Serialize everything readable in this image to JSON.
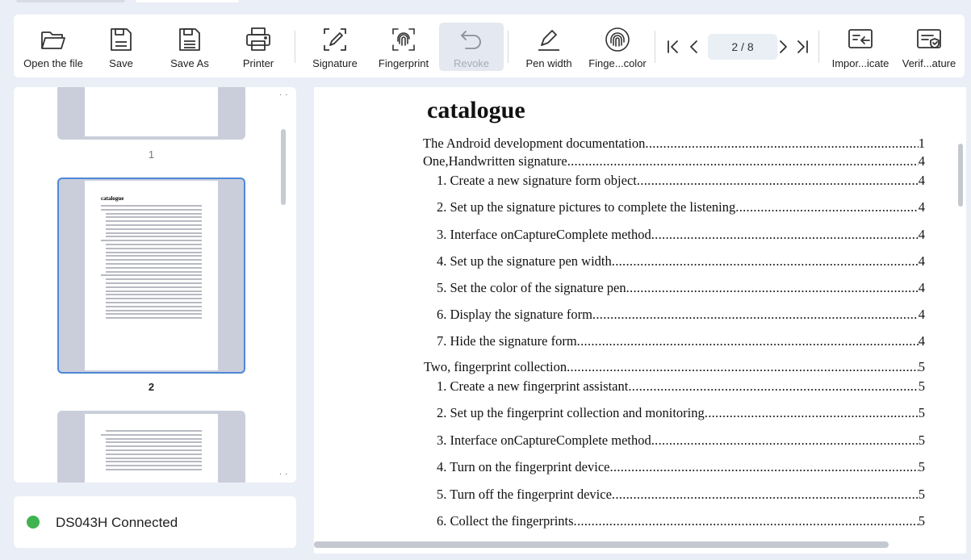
{
  "toolbar": {
    "open": "Open the file",
    "save": "Save",
    "save_as": "Save As",
    "printer": "Printer",
    "signature": "Signature",
    "fingerprint": "Fingerprint",
    "revoke": "Revoke",
    "pen_width": "Pen width",
    "fingerprint_color": "Finge...color",
    "page_indicator": "2 / 8",
    "import_certificate": "Impor...icate",
    "verify_signature": "Verif...ature"
  },
  "thumbnails": {
    "items": [
      {
        "label": "1"
      },
      {
        "label": "2"
      }
    ],
    "mini_title": "catalogue",
    "dots": ". ."
  },
  "status": {
    "text": "DS043H Connected",
    "color": "#3fb34f"
  },
  "document": {
    "title": "catalogue",
    "toc": [
      {
        "text": "The Android development documentation ",
        "page": "1"
      },
      {
        "text": "One,Handwritten signature",
        "page": "4"
      },
      {
        "text": "1. Create a new signature form object",
        "page": "4"
      },
      {
        "text": "2. Set up the signature pictures to complete the listening",
        "page": "4"
      },
      {
        "text": "3. Interface onCaptureComplete method",
        "page": "4"
      },
      {
        "text": "4. Set up the signature pen width",
        "page": "4"
      },
      {
        "text": "5. Set the color of the signature pen",
        "page": "4"
      },
      {
        "text": "6. Display the signature form",
        "page": "4"
      },
      {
        "text": "7. Hide the signature form",
        "page": "4"
      },
      {
        "text": "Two, fingerprint collection",
        "page": "5"
      },
      {
        "text": "1. Create a new fingerprint assistant",
        "page": "5"
      },
      {
        "text": "2. Set up the fingerprint collection and monitoring",
        "page": "5"
      },
      {
        "text": "3. Interface onCaptureComplete method",
        "page": "5"
      },
      {
        "text": "4. Turn on the fingerprint device",
        "page": "5"
      },
      {
        "text": "5. Turn off the fingerprint device",
        "page": "5"
      },
      {
        "text": "6. Collect the fingerprints",
        "page": "5"
      }
    ]
  },
  "colors": {
    "accent": "#4f87d8",
    "background": "#eaeef6"
  }
}
